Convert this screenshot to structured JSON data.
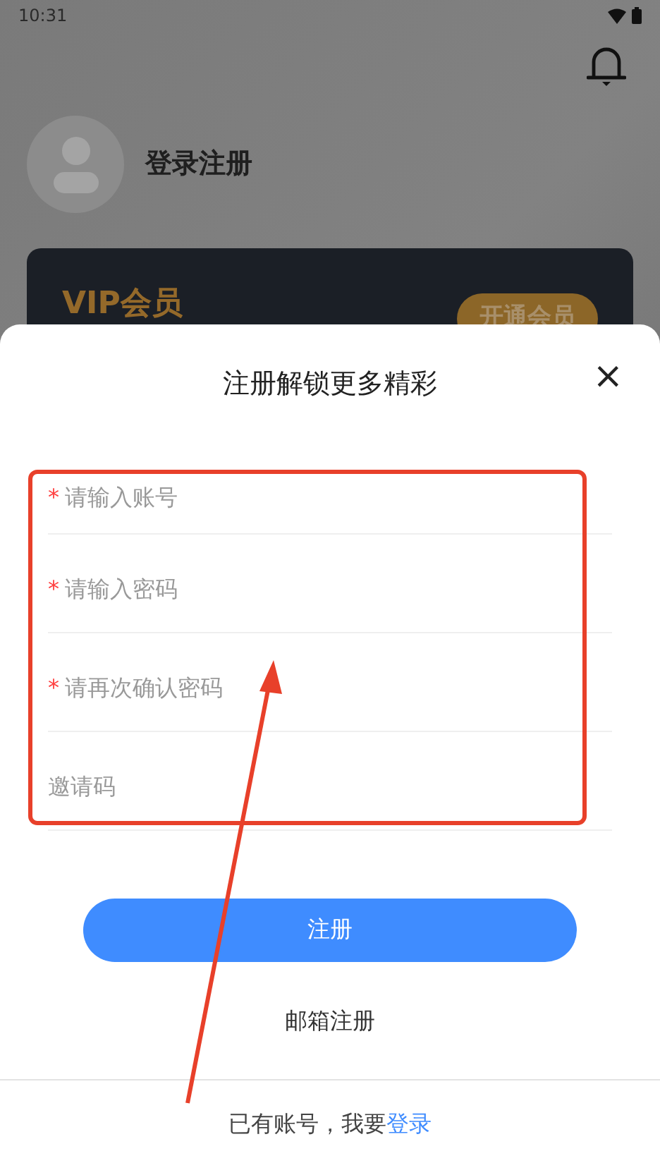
{
  "status_bar": {
    "time": "10:31"
  },
  "profile": {
    "name": "登录注册"
  },
  "vip_card": {
    "title": "VIP会员",
    "button": "开通会员"
  },
  "sheet": {
    "title": "注册解锁更多精彩",
    "close": "×",
    "fields": [
      {
        "required_mark": "*",
        "placeholder": "请输入账号"
      },
      {
        "required_mark": "*",
        "placeholder": "请输入密码"
      },
      {
        "required_mark": "*",
        "placeholder": "请再次确认密码"
      },
      {
        "placeholder": "邀请码"
      }
    ],
    "submit": "注册",
    "alt_link": "邮箱注册",
    "footer": {
      "text": "已有账号，我要",
      "link": "登录"
    }
  }
}
